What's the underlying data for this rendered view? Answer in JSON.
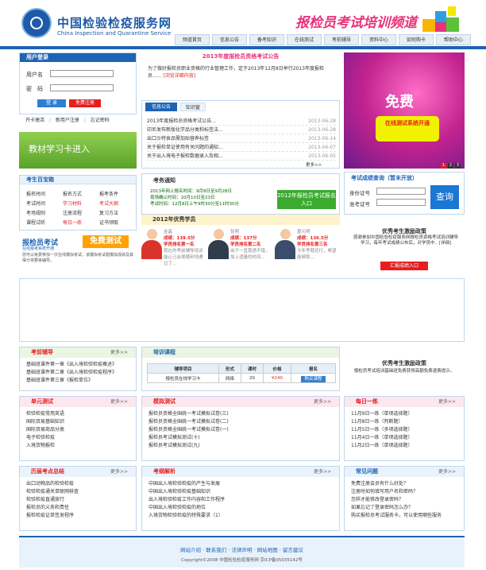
{
  "header": {
    "site_name": "中国检验检疫服务网",
    "site_name_en": "China Inspection and Quarantine Service",
    "channel_title": "报检员考试培训频道",
    "nav": [
      "频道首页",
      "信息公告",
      "备考知识",
      "在线测试",
      "考前辅导",
      "资料中心",
      "如何购卡",
      "帮助中心"
    ]
  },
  "login": {
    "title": "用户登录",
    "username_label": "用户名",
    "password_label": "密　码",
    "login_button": "登 录",
    "register_button": "免费注册",
    "links": [
      "开卡激活",
      "新用户注册",
      "忘记密码"
    ]
  },
  "card_entry": "教材学习卡进入",
  "notice": {
    "title": "2013年度报检员资格考试公告",
    "body": "为了做好报检员职业资格的行业管理工作，定于2013年12月8日举行2013年度报检员......",
    "detail_link": "[浏览详细内容]"
  },
  "ad": {
    "free": "免费",
    "badge": "在线测试系统开通",
    "pages": [
      "1",
      "2",
      "3"
    ],
    "colors": {
      "badge": "#f2f200"
    }
  },
  "news": {
    "tabs": [
      "信息公告",
      "知识窗"
    ],
    "items": [
      {
        "title": "2013年度报检员资格考试公告...",
        "date": "2013-06-28"
      },
      {
        "title": "印尼发布新版化学品分类和标签法...",
        "date": "2013-06-28"
      },
      {
        "title": "出口沙特食品需加贴营养标签",
        "date": "2013-06-14"
      },
      {
        "title": "关于报检单证使用有关问题的通知...",
        "date": "2013-06-07"
      },
      {
        "title": "关于出入境电子报检数据录入及相...",
        "date": "2013-06-05"
      }
    ],
    "more": "更多>>"
  },
  "toolbox": {
    "title": "考生百宝箱",
    "items": [
      {
        "label": "报名时间",
        "hot": false
      },
      {
        "label": "报名方式",
        "hot": false
      },
      {
        "label": "报考条件",
        "hot": false
      },
      {
        "label": "考试时间",
        "hot": false
      },
      {
        "label": "学习材料",
        "hot": true
      },
      {
        "label": "考试大纲",
        "hot": true
      },
      {
        "label": "考场规则",
        "hot": false
      },
      {
        "label": "注册流程",
        "hot": false
      },
      {
        "label": "复习方法",
        "hot": false
      },
      {
        "label": "课程试听",
        "hot": false
      },
      {
        "label": "每日一练",
        "hot": true
      },
      {
        "label": "证书领取",
        "hot": false
      }
    ]
  },
  "mock_test": {
    "title": "报检员考试",
    "subtitle": "在线报考系统开通",
    "badge": "免费测试",
    "desc": "您可以免费参加一次在线模拟考试，该模拟考试题模拟成绩及其得分将要来辅导。"
  },
  "exam_notice": {
    "title": "考务通知",
    "lines": [
      "2013年网上报名时间：9月8日至9月28日",
      "现场确认时间：10月10日至23日",
      "考试时间：12月8日上午9时30分至11时30分"
    ],
    "button": "2012年报检员考试报名入口"
  },
  "score_query": {
    "title": "考试成绩查询（暂未开放）",
    "id_label": "身份证号",
    "ticket_label": "准考证号",
    "button": "查询"
  },
  "students": {
    "title": "2012年优秀学员",
    "list": [
      {
        "name": "金晶",
        "score": "成绩：139.5分",
        "rank": "学员排名第一名",
        "quote": "我在的考前辅导培训能让己会很顺利地通过了..."
      },
      {
        "name": "张明",
        "score": "成绩：137分",
        "rank": "学员排名第二名",
        "quote": "由于一直我语不错，加上适量的时间..."
      },
      {
        "name": "夏元明",
        "score": "成绩：136.5分",
        "rank": "学员排名第三名",
        "quote": "今年考题还行，希望能够取..."
      }
    ]
  },
  "policy": {
    "title": "优秀考生激励政策",
    "desc": "感谢参加中国检验检疫服务网报检员资格考试培训辅导学习，每年考试成绩公布后，对学员中.. [详细]",
    "button": "汇报成绩入口"
  },
  "coaching": {
    "title": "考前辅导",
    "more": "更多>>",
    "items": [
      "基础班课件第一章《出入境检验检疫概述》",
      "基础班课件第二章《出入境检验检疫程序》",
      "基础班课件第三章《报检单位》"
    ]
  },
  "training": {
    "title": "培训课程",
    "headers": [
      "辅导项目",
      "形式",
      "课时",
      "价格",
      "报名"
    ],
    "row": [
      "报检员在线学习卡",
      "网络",
      "20",
      "¥240",
      "购买课程"
    ],
    "policy_title": "优秀考生激励政策",
    "policy_desc": "报检员考试培训基础班免费获得高额免费退费提示。"
  },
  "unit_test": {
    "title": "单元测试",
    "more": "更多>>",
    "items": [
      "检验检疫常用英语",
      "国际贸易基础知识",
      "国际贸易商品分类",
      "电子检验检疫",
      "入境货物报检"
    ]
  },
  "mock_exam": {
    "title": "模拟测试",
    "more": "更多>>",
    "items": [
      "报检员资格全国统一考试模拟试卷(三)",
      "报检员资格全国统一考试模拟试卷(二)",
      "报检员资格全国统一考试模拟试卷(一)",
      "报检员考试模拟测试(十)",
      "报检员考试模拟测试(九)"
    ]
  },
  "daily": {
    "title": "每日一练",
    "more": "更多>>",
    "items": [
      "11月9日一练（单项选择题）",
      "11月8日一练（判断题）",
      "11月5日一练（多项选择题）",
      "11月4日一练（单项选择题）",
      "11月2日一练（单项选择题）"
    ]
  },
  "key_points": {
    "title": "历届考点总结",
    "more": "更多>>",
    "items": [
      "出口动物品的检验检疫",
      "检验检疫通关单联网核查",
      "检验检疫直通放行",
      "报检员的义务和责任",
      "报检检疫证单签发程序"
    ]
  },
  "analysis": {
    "title": "考纲解析",
    "more": "更多>>",
    "items": [
      "中国出入境检验检疫的产生与发展",
      "中国出入境检验检疫基础知识",
      "出入境检验检疫工作内容和工作程序",
      "中国出入境检验检疫的地位",
      "入境货物检验检疫的特殊要求（1）"
    ]
  },
  "faq": {
    "title": "常见问题",
    "more": "更多>>",
    "items": [
      "免费注册会员有什么好处？",
      "注册时如何填写用户名和密码？",
      "怎样才能修改登录密码？",
      "如果忘记了登录密码怎么办？",
      "购买报检员考试服务卡，可以使用哪些服务"
    ]
  },
  "footer": {
    "links": "网站介绍 · 联系我们 · 法律声明 · 网站地图 · 留言建议",
    "copyright": "Copyright©2008 中国检验检疫服务网 京ICP备05035142号"
  }
}
